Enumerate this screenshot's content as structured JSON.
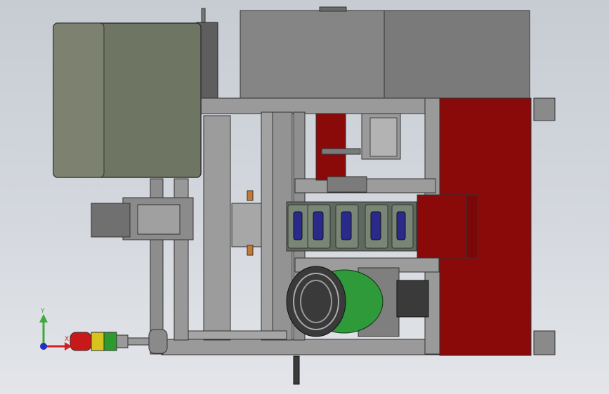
{
  "viewport": {
    "background_top": "#c7ccd3",
    "background_bottom": "#e3e5e9"
  },
  "triad": {
    "y_label": "Y",
    "x_label": "X",
    "y_color": "#3fa83f",
    "x_color": "#d02020",
    "z_color": "#2030c0"
  },
  "colors": {
    "frame_gray": "#8a8a8a",
    "frame_light": "#a9a9a9",
    "panel_olive": "#6f7563",
    "cabinet_gray": "#7c7c7c",
    "guard_red": "#8a0a0a",
    "drum_green": "#2f9a3a",
    "indicator_red": "#c81818",
    "indicator_yellow": "#d6c31c",
    "indicator_green": "#2c9a2c",
    "fixture_blue": "#2a2a8a"
  }
}
